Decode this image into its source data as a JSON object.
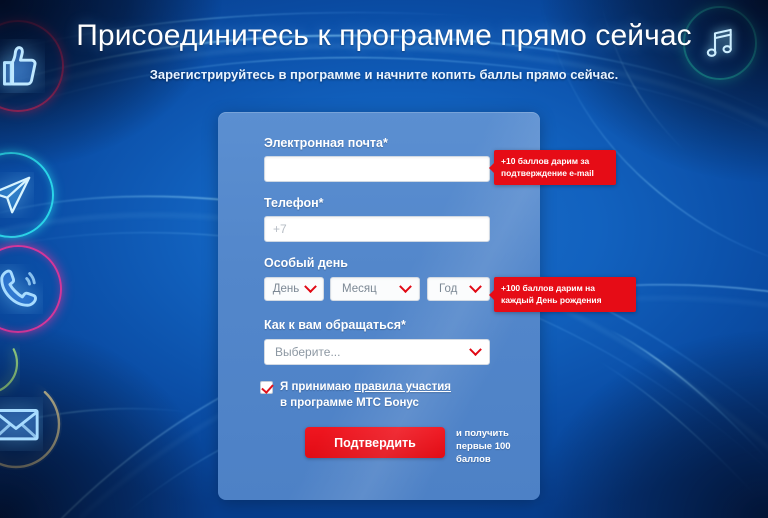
{
  "header": {
    "title": "Присоединитесь к программе прямо сейчас",
    "subtitle": "Зарегистрируйтесь в программе и начните копить баллы прямо сейчас."
  },
  "form": {
    "email": {
      "label": "Электронная почта*",
      "value": "",
      "placeholder": ""
    },
    "phone": {
      "label": "Телефон*",
      "value": "",
      "placeholder": "+7"
    },
    "birthday": {
      "label": "Особый день",
      "day": "День",
      "month": "Месяц",
      "year": "Год"
    },
    "salutation": {
      "label": "Как к вам обращаться*",
      "selected": "Выберите..."
    },
    "agreement": {
      "prefix": "Я принимаю ",
      "link": "правила участия",
      "suffix": "",
      "line2": "в программе МТС Бонус",
      "checked": true
    },
    "submit_label": "Подтвердить",
    "submit_note": "и получить первые 100 баллов"
  },
  "tooltips": {
    "email": "+10 баллов дарим за подтверждение e-mail",
    "birthday": "+100 баллов дарим на каждый День рождения"
  },
  "icons": [
    {
      "name": "thumbs-up-icon",
      "ring_color": "#e8377f"
    },
    {
      "name": "paper-plane-icon",
      "ring_color": "#2ad4e8"
    },
    {
      "name": "phone-icon",
      "ring_color": "#d4369a"
    },
    {
      "name": "partial-ring-icon",
      "ring_color": "#9fe08a"
    },
    {
      "name": "envelope-icon",
      "ring_color": "#f2e6b0"
    },
    {
      "name": "music-note-icon",
      "ring_color": "#24d3d8"
    }
  ],
  "colors": {
    "accent_red": "#e60c16",
    "panel_blue": "#5387cb",
    "background_blue": "#0d59b4"
  }
}
